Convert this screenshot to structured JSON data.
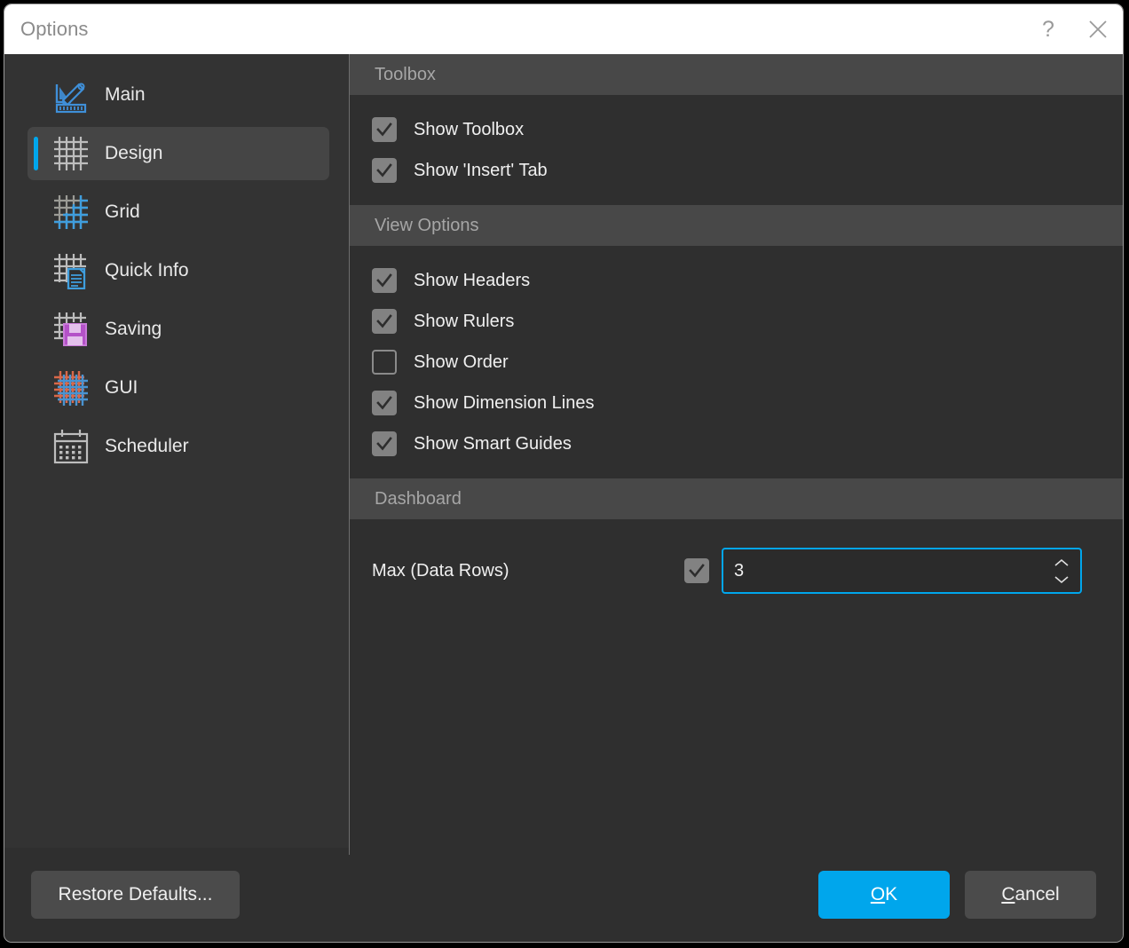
{
  "window": {
    "title": "Options",
    "help_icon": "question-mark-icon",
    "close_icon": "close-icon"
  },
  "sidebar": {
    "items": [
      {
        "label": "Main",
        "icon": "pencil-ruler-icon",
        "selected": false
      },
      {
        "label": "Design",
        "icon": "grid-icon",
        "selected": true
      },
      {
        "label": "Grid",
        "icon": "grid-blue-icon",
        "selected": false
      },
      {
        "label": "Quick Info",
        "icon": "grid-document-icon",
        "selected": false
      },
      {
        "label": "Saving",
        "icon": "grid-floppy-icon",
        "selected": false
      },
      {
        "label": "GUI",
        "icon": "grid-mesh-icon",
        "selected": false
      },
      {
        "label": "Scheduler",
        "icon": "calendar-icon",
        "selected": false
      }
    ]
  },
  "content": {
    "sections": [
      {
        "title": "Toolbox",
        "checkboxes": [
          {
            "label": "Show Toolbox",
            "checked": true
          },
          {
            "label": "Show 'Insert' Tab",
            "checked": true
          }
        ]
      },
      {
        "title": "View Options",
        "checkboxes": [
          {
            "label": "Show Headers",
            "checked": true
          },
          {
            "label": "Show Rulers",
            "checked": true
          },
          {
            "label": "Show Order",
            "checked": false
          },
          {
            "label": "Show Dimension Lines",
            "checked": true
          },
          {
            "label": "Show Smart Guides",
            "checked": true
          }
        ]
      }
    ],
    "dashboard": {
      "title": "Dashboard",
      "max_data_rows": {
        "label": "Max (Data Rows)",
        "enabled": true,
        "value": "3",
        "up_icon": "chevron-up-icon",
        "down_icon": "chevron-down-icon"
      }
    }
  },
  "footer": {
    "restore_defaults": "Restore Defaults...",
    "ok": "OK",
    "ok_mnemonic": "O",
    "ok_rest": "K",
    "cancel": "Cancel",
    "cancel_mnemonic": "C",
    "cancel_rest": "ancel"
  },
  "colors": {
    "accent": "#00a6ec",
    "window_bg": "#2f2f2f",
    "sidebar_bg": "#333333",
    "section_header_bg": "#484848",
    "titlebar_bg": "#ffffff",
    "checkbox_on": "#828282",
    "button_bg": "#4b4b4b",
    "icon_gray": "#bdbdbd",
    "icon_purple": "#b452c8",
    "icon_orange": "#d9684a"
  }
}
